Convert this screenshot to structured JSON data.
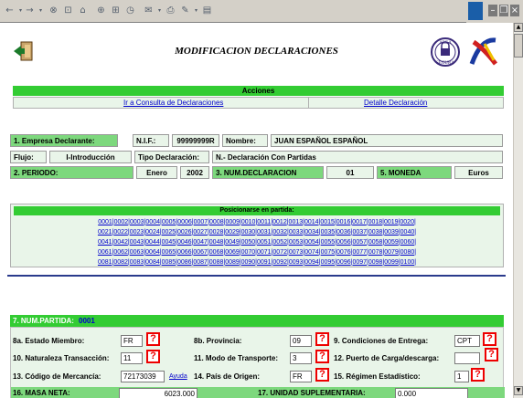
{
  "header": {
    "title": "MODIFICACION DECLARACIONES",
    "seal_text": [
      "AREA",
      "SEGURA"
    ]
  },
  "acciones": {
    "title": "Acciones",
    "link_consulta": "Ir a Consulta de Declaraciones",
    "link_detalle": "Detalle Declaración"
  },
  "empresa": {
    "label": "1. Empresa Declarante:",
    "nif_label": "N.I.F.:",
    "nif_value": "99999999R",
    "nombre_label": "Nombre:",
    "nombre_value": "JUAN ESPAÑOL ESPAÑOL"
  },
  "flujo": {
    "label": "Flujo:",
    "value": "I-Introducción",
    "tipo_label": "Tipo Declaración:",
    "tipo_value": "N.- Declaración Con Partidas"
  },
  "periodo": {
    "label": "2. PERIODO:",
    "mes": "Enero",
    "anio": "2002",
    "num_label": "3. NUM.DECLARACION",
    "num_value": "01",
    "moneda_label": "5. MONEDA",
    "moneda_value": "Euros"
  },
  "partidas": {
    "title": "Posicionarse en partida:",
    "rows": [
      [
        "0001",
        "0002",
        "0003",
        "0004",
        "0005",
        "0006",
        "0007",
        "0008",
        "0009",
        "0010",
        "0011",
        "0012",
        "0013",
        "0014",
        "0015",
        "0016",
        "0017",
        "0018",
        "0019",
        "0020"
      ],
      [
        "0021",
        "0022",
        "0023",
        "0024",
        "0025",
        "0026",
        "0027",
        "0028",
        "0029",
        "0030",
        "0031",
        "0032",
        "0033",
        "0034",
        "0035",
        "0036",
        "0037",
        "0038",
        "0039",
        "0040"
      ],
      [
        "0041",
        "0042",
        "0043",
        "0044",
        "0045",
        "0046",
        "0047",
        "0048",
        "0049",
        "0050",
        "0051",
        "0052",
        "0053",
        "0054",
        "0055",
        "0056",
        "0057",
        "0058",
        "0059",
        "0060"
      ],
      [
        "0061",
        "0062",
        "0063",
        "0064",
        "0065",
        "0066",
        "0067",
        "0068",
        "0069",
        "0070",
        "0071",
        "0072",
        "0073",
        "0074",
        "0075",
        "0076",
        "0077",
        "0078",
        "0079",
        "0080"
      ],
      [
        "0081",
        "0082",
        "0083",
        "0084",
        "0085",
        "0086",
        "0087",
        "0088",
        "0089",
        "0090",
        "0091",
        "0092",
        "0093",
        "0094",
        "0095",
        "0096",
        "0097",
        "0098",
        "0099",
        "0100"
      ]
    ]
  },
  "partida": {
    "label": "7. NUM.PARTIDA:",
    "value": "0001",
    "estado_label": "8a. Estado Miembro:",
    "estado_value": "FR",
    "provincia_label": "8b. Provincia:",
    "provincia_value": "09",
    "condiciones_label": "9. Condiciones de Entrega:",
    "condiciones_value": "CPT",
    "naturaleza_label": "10. Naturaleza Transacción:",
    "naturaleza_value": "11",
    "modo_label": "11. Modo de Transporte:",
    "modo_value": "3",
    "puerto_label": "12. Puerto de Carga/descarga:",
    "puerto_value": "",
    "codigo_label": "13. Código de Mercancía:",
    "codigo_value": "72173039",
    "ayuda": "Ayuda",
    "pais_label": "14. País de Origen:",
    "pais_value": "FR",
    "regimen_label": "15. Régimen Estadístico:",
    "regimen_value": "1",
    "masa_label": "16. MASA NETA:",
    "masa_value": "6023.000",
    "unidad_label": "17. UNIDAD SUPLEMENTARIA:",
    "unidad_value": "0.000",
    "help_symbol": "?"
  },
  "colors": {
    "green_bar": "#33cc33",
    "green_label": "#7dd87d",
    "light_green": "#e9f5e9",
    "link": "#0000cc",
    "rule": "#2a3a8c",
    "help_red": "#ee0000"
  },
  "icons": [
    "back-arrow-icon",
    "forward-arrow-icon",
    "stop-icon",
    "refresh-icon",
    "home-icon",
    "search-icon",
    "favorites-icon",
    "history-icon",
    "mail-icon",
    "print-icon",
    "edit-icon",
    "discuss-icon",
    "exit-door-icon",
    "seal-icon",
    "agency-logo-icon"
  ]
}
